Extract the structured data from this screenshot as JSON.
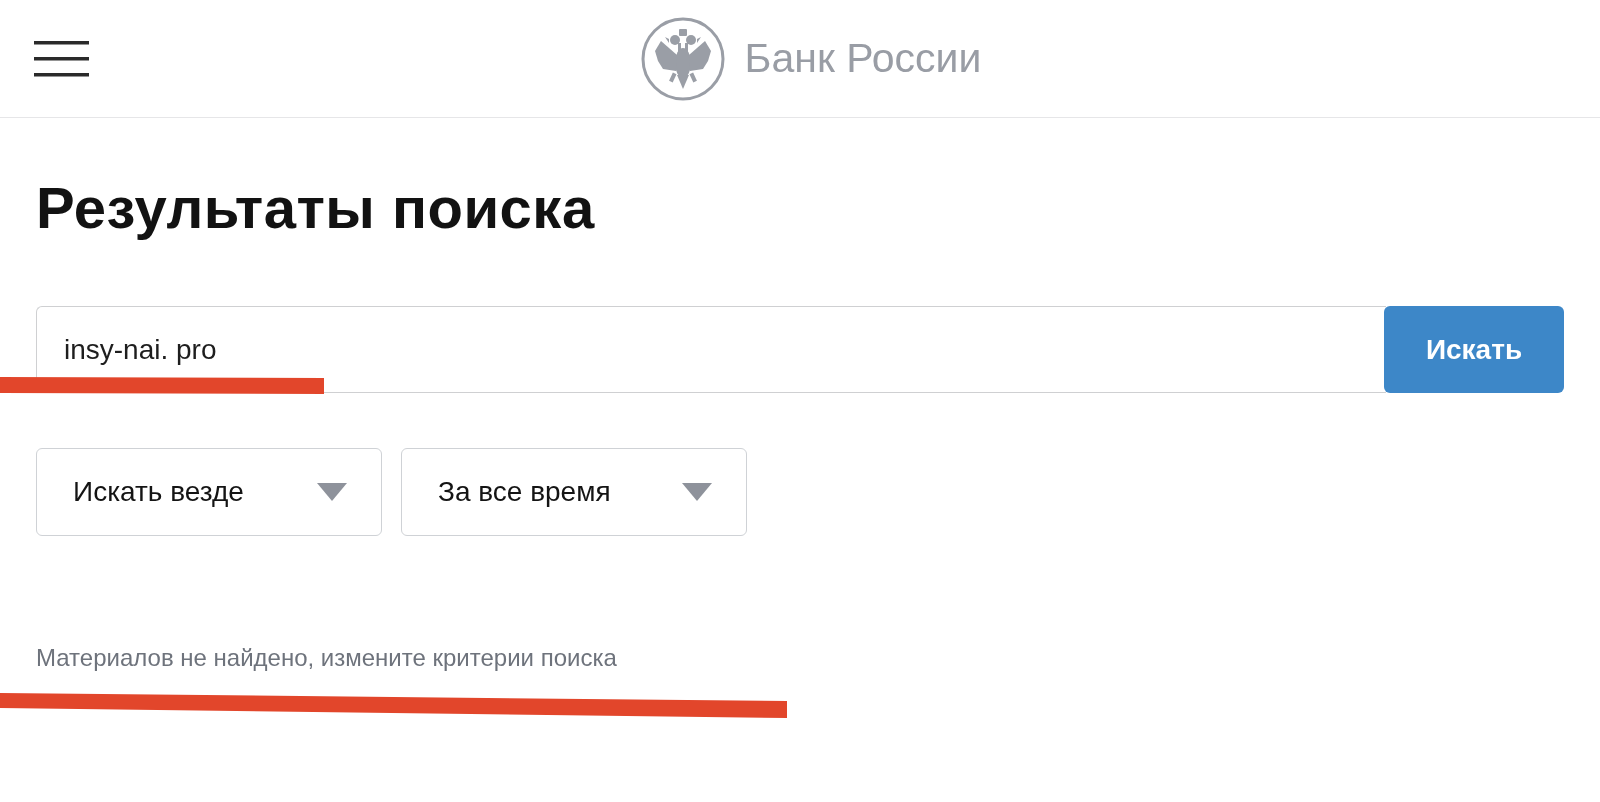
{
  "header": {
    "logo_text": "Банк России"
  },
  "title": "Результаты поиска",
  "search": {
    "value": "insy-nai. pro",
    "button": "Искать"
  },
  "filters": [
    {
      "label": "Искать везде"
    },
    {
      "label": "За все время"
    }
  ],
  "message": "Материалов не найдено, измените критерии поиска"
}
